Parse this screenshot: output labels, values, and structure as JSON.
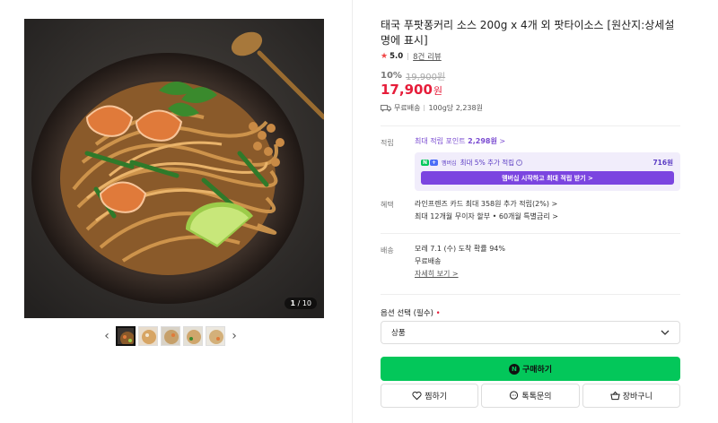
{
  "gallery": {
    "counter_current": "1",
    "counter_total": "/ 10",
    "prev_arrow": "‹",
    "next_arrow": "›"
  },
  "product": {
    "title": "태국 푸팟퐁커리 소스 200g x 4개 외 팟타이소스 [원산지:상세설명에 표시]",
    "rating": "5.0",
    "reviews": "8건 리뷰",
    "discount": "10%",
    "original_price": "19,900원",
    "price": "17,900",
    "price_unit": "원",
    "shipping": "무료배송",
    "unit_price": "100g당 2,238원"
  },
  "points": {
    "label": "적립",
    "max_points_prefix": "최대 적립 포인트 ",
    "max_points_value": "2,298원",
    "member_badge_n": "N",
    "member_badge_plus": "+",
    "member_badge_text": "멤버십",
    "member_text": "최대 5% 추가 적립",
    "member_points": "716원",
    "member_button": "멤버십 시작하고 최대 적립 받기 >"
  },
  "benefits": {
    "label": "혜택",
    "line1": "라인프렌즈 카드 최대 358원 추가 적립(2%) >",
    "line2": "최대 12개월 무이자 할부 • 60개월 특별금리 >"
  },
  "delivery": {
    "label": "배송",
    "line1": "모레 7.1 (수) 도착 확률 94%",
    "line2": "무료배송",
    "link": "자세히 보기 >"
  },
  "option": {
    "label": "옵션 선택 (필수)",
    "required_mark": "•",
    "selected": "상품"
  },
  "buttons": {
    "buy_icon": "N",
    "buy": "구매하기",
    "wish": "찜하기",
    "talk": "톡톡문의",
    "cart": "장바구니"
  },
  "colors": {
    "accent_green": "#03c75a",
    "price_red": "#e61d3a",
    "member_purple": "#7b45e0"
  }
}
